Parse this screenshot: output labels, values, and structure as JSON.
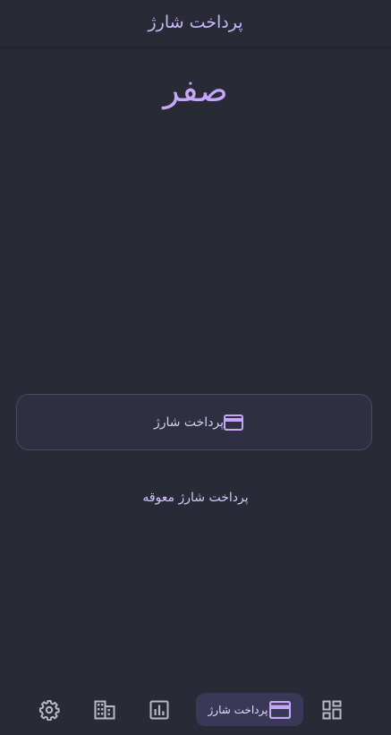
{
  "app_bar": {
    "title": "پرداخت شارژ"
  },
  "main": {
    "amount": "صفر",
    "pay_button_label": "پرداخت شارژ",
    "delayed_payment_label": "پرداخت شارژ معوقه"
  },
  "bottom_nav": {
    "items": [
      {
        "icon": "dashboard-icon"
      },
      {
        "icon": "credit-card-icon",
        "label": "پرداخت شارژ",
        "active": true
      },
      {
        "icon": "bar-chart-icon"
      },
      {
        "icon": "apartment-building-icon"
      },
      {
        "icon": "settings-gear-icon"
      }
    ]
  },
  "colors": {
    "background": "#282a36",
    "accent": "#c6a6f7",
    "active_nav_bg": "#3a3857",
    "inactive_icon": "#b9b9c4"
  }
}
